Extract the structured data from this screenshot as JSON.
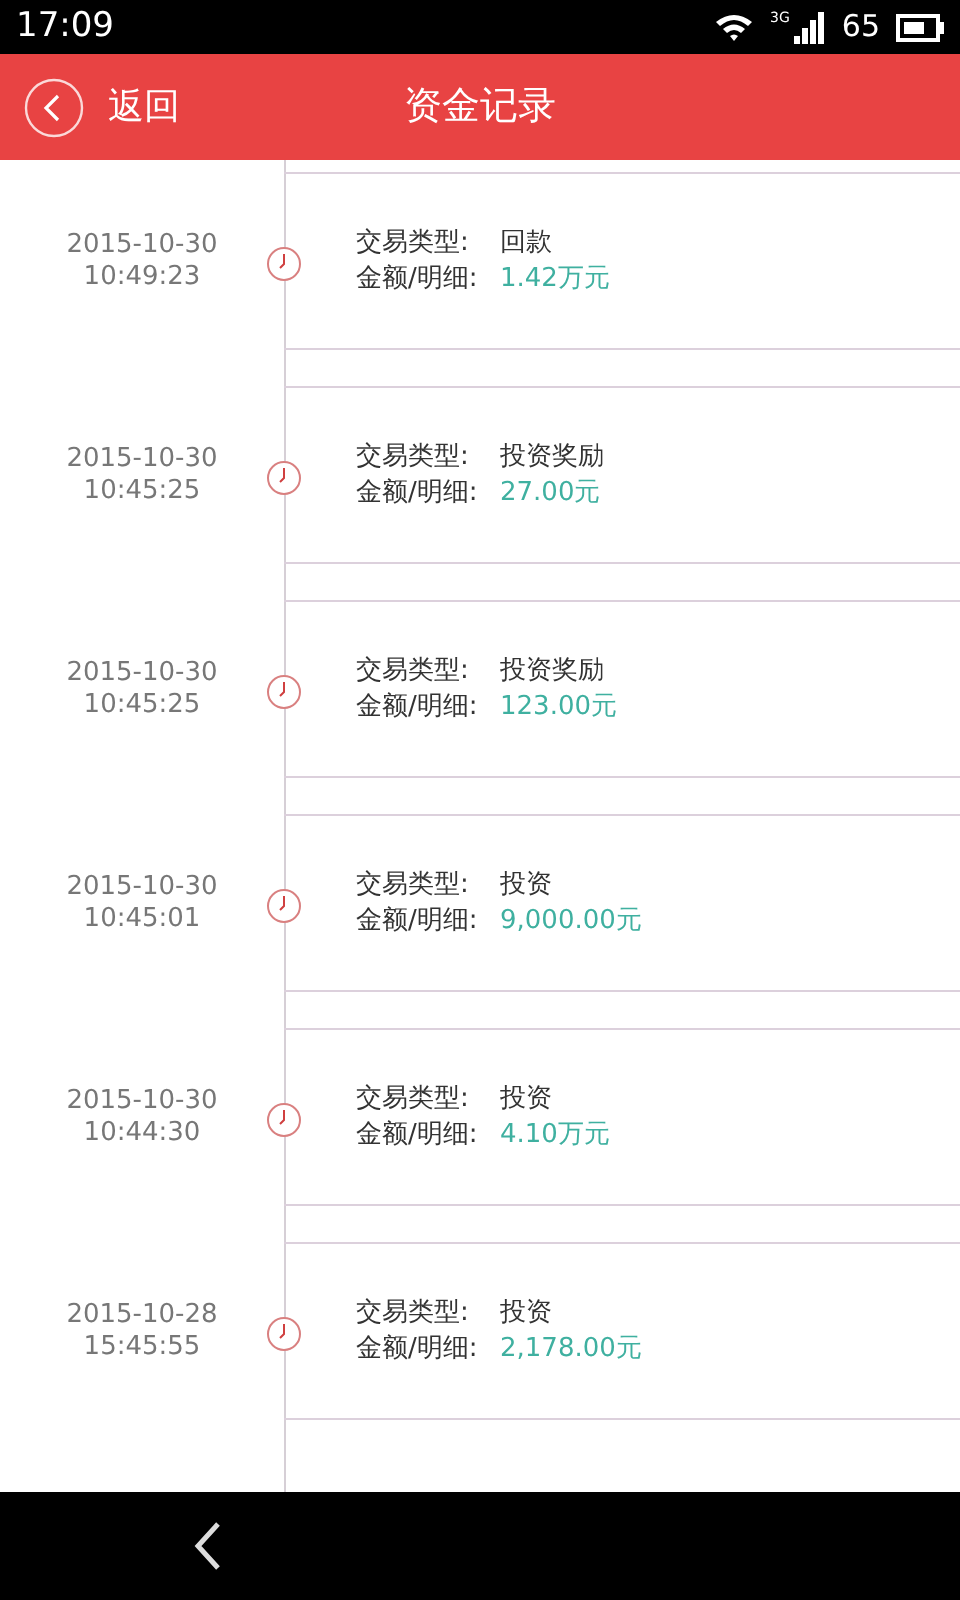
{
  "status_bar": {
    "time": "17:09",
    "network": "3G",
    "battery": "65"
  },
  "header": {
    "back_label": "返回",
    "title": "资金记录"
  },
  "records": [
    {
      "date": "2015-10-30",
      "time": "10:49:23",
      "type_label": "交易类型:",
      "type": "回款",
      "amount_label": "金额/明细:",
      "amount": "1.42万元"
    },
    {
      "date": "2015-10-30",
      "time": "10:45:25",
      "type_label": "交易类型:",
      "type": "投资奖励",
      "amount_label": "金额/明细:",
      "amount": "27.00元"
    },
    {
      "date": "2015-10-30",
      "time": "10:45:25",
      "type_label": "交易类型:",
      "type": "投资奖励",
      "amount_label": "金额/明细:",
      "amount": "123.00元"
    },
    {
      "date": "2015-10-30",
      "time": "10:45:01",
      "type_label": "交易类型:",
      "type": "投资",
      "amount_label": "金额/明细:",
      "amount": "9,000.00元"
    },
    {
      "date": "2015-10-30",
      "time": "10:44:30",
      "type_label": "交易类型:",
      "type": "投资",
      "amount_label": "金额/明细:",
      "amount": "4.10万元"
    },
    {
      "date": "2015-10-28",
      "time": "15:45:55",
      "type_label": "交易类型:",
      "type": "投资",
      "amount_label": "金额/明细:",
      "amount": "2,178.00元"
    }
  ]
}
